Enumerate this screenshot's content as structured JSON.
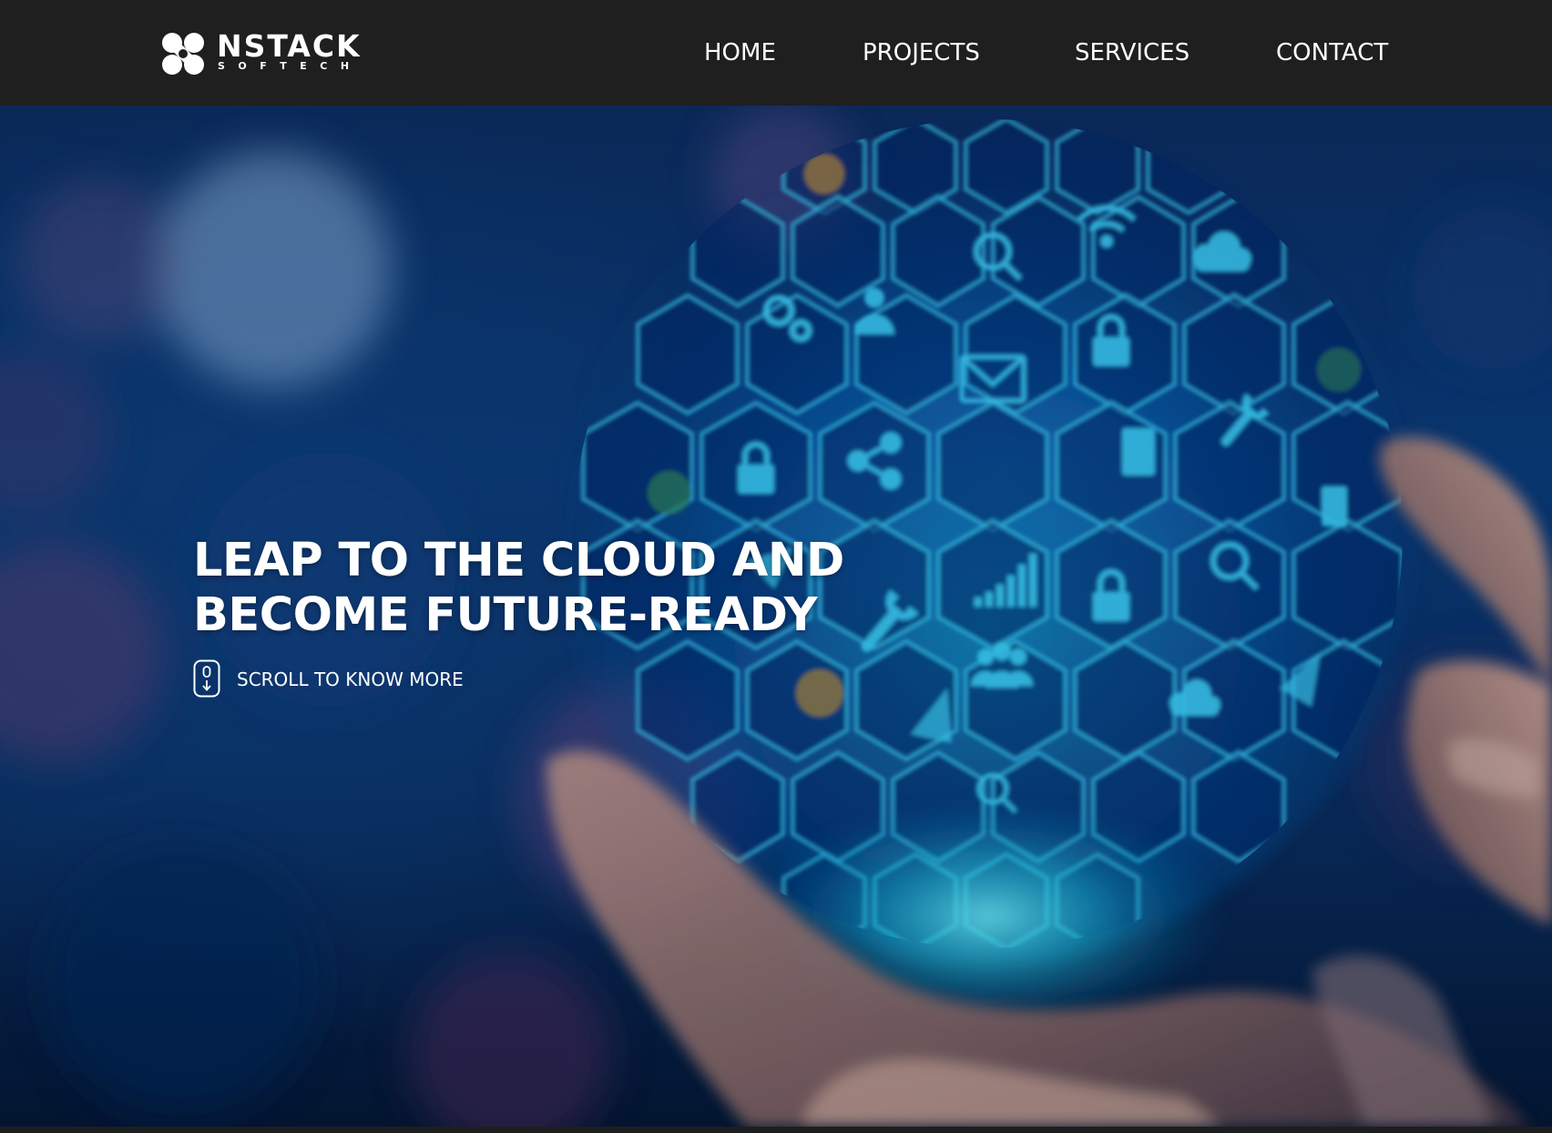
{
  "brand": {
    "name": "NSTACK",
    "tagline": "SOFTECH"
  },
  "nav": {
    "items": [
      {
        "label": "HOME"
      },
      {
        "label": "PROJECTS"
      },
      {
        "label": "SERVICES"
      },
      {
        "label": "CONTACT"
      }
    ]
  },
  "hero": {
    "headline_line1": "LEAP TO THE CLOUD AND",
    "headline_line2": "BECOME FUTURE-READY",
    "scroll_label": "SCROLL TO KNOW MORE"
  },
  "colors": {
    "header_bg": "#1f1f1f",
    "text": "#ffffff",
    "hero_blue": "#0a3a78",
    "glow_cyan": "#2fe0f0"
  }
}
